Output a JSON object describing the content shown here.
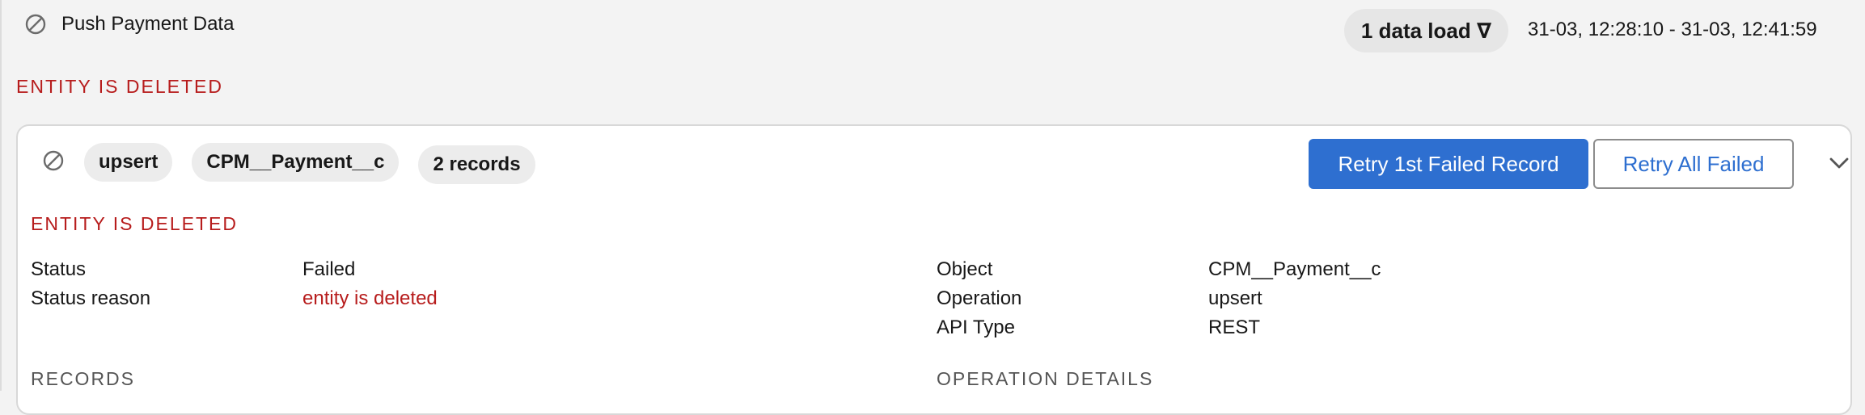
{
  "header": {
    "title": "Push Payment Data",
    "data_load": "1 data load ∇",
    "date_range": "31-03, 12:28:10 - 31-03, 12:41:59",
    "error": "ENTITY IS DELETED"
  },
  "card": {
    "chips": {
      "operation": "upsert",
      "object": "CPM__Payment__c",
      "records": "2 records"
    },
    "buttons": {
      "retry_first": "Retry 1st Failed Record",
      "retry_all": "Retry All Failed"
    },
    "error": "ENTITY IS DELETED",
    "details_left": {
      "status_label": "Status",
      "status_value": "Failed",
      "reason_label": "Status reason",
      "reason_value": "entity is deleted"
    },
    "details_right": {
      "object_label": "Object",
      "object_value": "CPM__Payment__c",
      "operation_label": "Operation",
      "operation_value": "upsert",
      "api_label": "API Type",
      "api_value": "REST"
    },
    "sections": {
      "records": "RECORDS",
      "operation_details": "OPERATION DETAILS"
    }
  },
  "icons": {
    "title_icon": "ban-icon",
    "card_icon": "ban-icon",
    "expand_icon": "chevron-down-icon"
  },
  "colors": {
    "error": "#b71c1c",
    "primary": "#2e6fd0"
  }
}
